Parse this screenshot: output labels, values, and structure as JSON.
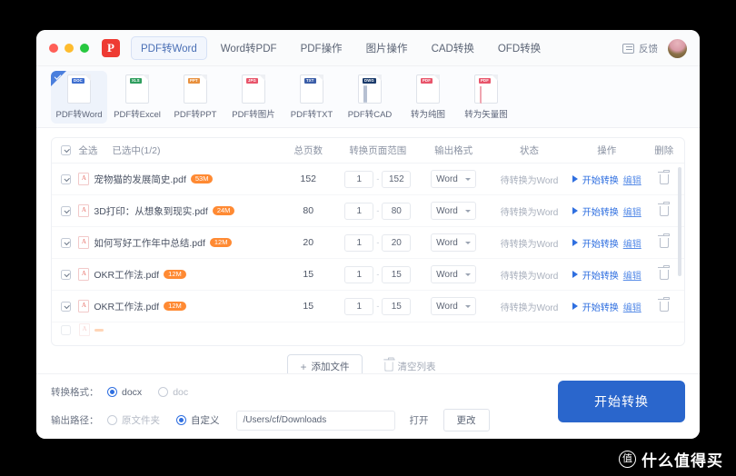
{
  "window": {
    "traffic_lights": [
      "close",
      "minimize",
      "maximize"
    ],
    "logo_letter": "P",
    "nav_tabs": [
      {
        "label": "PDF转Word",
        "active": true
      },
      {
        "label": "Word转PDF",
        "active": false
      },
      {
        "label": "PDF操作",
        "active": false
      },
      {
        "label": "图片操作",
        "active": false
      },
      {
        "label": "CAD转换",
        "active": false
      },
      {
        "label": "OFD转换",
        "active": false
      }
    ],
    "feedback_label": "反馈"
  },
  "tools": [
    {
      "label": "PDF转Word",
      "tag": "DOC",
      "tag_color": "#3f6fd0",
      "accent": "#5b8ad8",
      "selected": true
    },
    {
      "label": "PDF转Excel",
      "tag": "XLS",
      "tag_color": "#2f9e5e",
      "accent": "#53b37c",
      "selected": false
    },
    {
      "label": "PDF转PPT",
      "tag": "PPT",
      "tag_color": "#e8913f",
      "accent": "#eda45f",
      "selected": false
    },
    {
      "label": "PDF转图片",
      "tag": "JPG",
      "tag_color": "#e8556b",
      "accent": "#ef8a9a",
      "selected": false
    },
    {
      "label": "PDF转TXT",
      "tag": "TXT",
      "tag_color": "#3b5ea8",
      "accent": "#7b8ab0",
      "selected": false
    },
    {
      "label": "PDF转CAD",
      "tag": "DWG",
      "tag_color": "#1b3b6b",
      "accent": "#6d7f9c",
      "selected": false
    },
    {
      "label": "转为纯图",
      "tag": "PDF",
      "tag_color": "#e8556b",
      "accent": "#ef8a9a",
      "selected": false
    },
    {
      "label": "转为矢量图",
      "tag": "PDF",
      "tag_color": "#e8556b",
      "accent": "#ef8a9a",
      "selected": false
    }
  ],
  "list": {
    "headers": {
      "select_all": "全选",
      "selected_count": "已选中(1/2)",
      "total_pages": "总页数",
      "page_range": "转换页面范围",
      "output_format": "输出格式",
      "status": "状态",
      "operation": "操作",
      "delete": "删除"
    },
    "rows": [
      {
        "checked": true,
        "name": "宠物猫的发展简史.pdf",
        "size": "53M",
        "pages": "152",
        "from": "1",
        "to": "152",
        "format": "Word",
        "status": "待转换为Word",
        "start": "开始转换",
        "edit": "编辑"
      },
      {
        "checked": true,
        "name": "3D打印：从想象到现实.pdf",
        "size": "24M",
        "pages": "80",
        "from": "1",
        "to": "80",
        "format": "Word",
        "status": "待转换为Word",
        "start": "开始转换",
        "edit": "编辑"
      },
      {
        "checked": true,
        "name": "如何写好工作年中总结.pdf",
        "size": "12M",
        "pages": "20",
        "from": "1",
        "to": "20",
        "format": "Word",
        "status": "待转换为Word",
        "start": "开始转换",
        "edit": "编辑"
      },
      {
        "checked": true,
        "name": "OKR工作法.pdf",
        "size": "12M",
        "pages": "15",
        "from": "1",
        "to": "15",
        "format": "Word",
        "status": "待转换为Word",
        "start": "开始转换",
        "edit": "编辑"
      },
      {
        "checked": true,
        "name": "OKR工作法.pdf",
        "size": "12M",
        "pages": "15",
        "from": "1",
        "to": "15",
        "format": "Word",
        "status": "待转换为Word",
        "start": "开始转换",
        "edit": "编辑"
      }
    ],
    "range_separator": "-"
  },
  "actions": {
    "add_file": "添加文件",
    "clear_list": "清空列表"
  },
  "settings": {
    "format_label": "转换格式：",
    "format_options": [
      {
        "label": "docx",
        "selected": true
      },
      {
        "label": "doc",
        "selected": false
      }
    ],
    "path_label": "输出路径：",
    "path_options": [
      {
        "label": "原文件夹",
        "selected": false
      },
      {
        "label": "自定义",
        "selected": true
      }
    ],
    "path_value": "/Users/cf/Downloads",
    "open_label": "打开",
    "change_label": "更改"
  },
  "convert_button": "开始转换",
  "watermark": {
    "mark": "值",
    "text": "什么值得买"
  },
  "colors": {
    "accent_blue": "#2a66cc",
    "link_blue": "#2f6fe0",
    "size_badge": "#ff8a33",
    "logo_red": "#ee3b33"
  }
}
